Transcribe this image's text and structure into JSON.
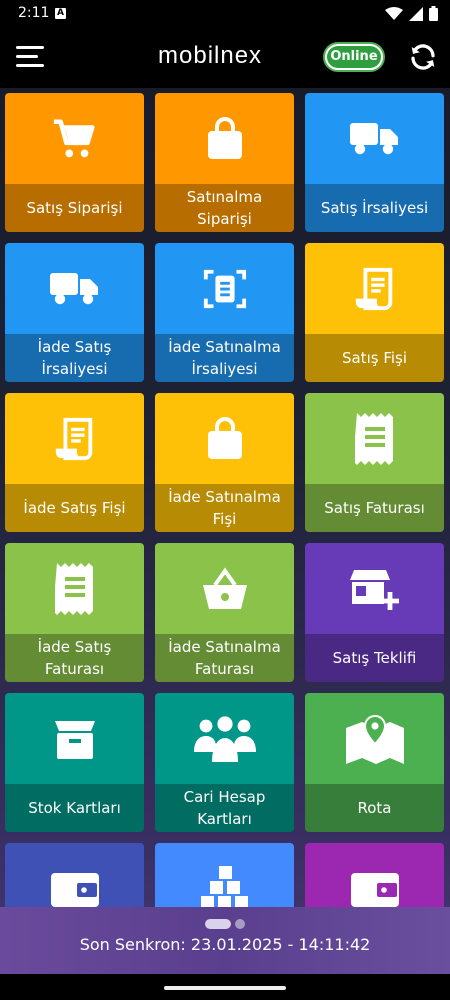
{
  "status_bar": {
    "time": "2:11",
    "notif_glyph": "A"
  },
  "app_bar": {
    "logo": "mobilnex",
    "online_label": "Online"
  },
  "tiles": [
    {
      "label": "Satış Siparişi",
      "color": "#ff9800",
      "icon": "cart-icon"
    },
    {
      "label": "Satınalma\nSiparişi",
      "color": "#ff9800",
      "icon": "shopping-bag-icon"
    },
    {
      "label": "Satış İrsaliyesi",
      "color": "#2196f3",
      "icon": "truck-icon"
    },
    {
      "label": "İade Satış\nİrsaliyesi",
      "color": "#2196f3",
      "icon": "truck-icon"
    },
    {
      "label": "İade Satınalma\nİrsaliyesi",
      "color": "#2196f3",
      "icon": "scan-document-icon"
    },
    {
      "label": "Satış Fişi",
      "color": "#ffc107",
      "icon": "receipt-scroll-icon"
    },
    {
      "label": "İade Satış Fişi",
      "color": "#ffc107",
      "icon": "receipt-scroll-icon"
    },
    {
      "label": "İade Satınalma\nFişi",
      "color": "#ffc107",
      "icon": "shopping-bag-icon"
    },
    {
      "label": "Satış Faturası",
      "color": "#8bc34a",
      "icon": "invoice-icon"
    },
    {
      "label": "İade Satış\nFaturası",
      "color": "#8bc34a",
      "icon": "invoice-icon"
    },
    {
      "label": "İade Satınalma\nFaturası",
      "color": "#8bc34a",
      "icon": "basket-icon"
    },
    {
      "label": "Satış Teklifi",
      "color": "#673ab7",
      "icon": "store-add-icon"
    },
    {
      "label": "Stok Kartları",
      "color": "#009688",
      "icon": "box-icon"
    },
    {
      "label": "Cari Hesap\nKartları",
      "color": "#009688",
      "icon": "users-icon"
    },
    {
      "label": "Rota",
      "color": "#4caf50",
      "icon": "map-pin-icon"
    },
    {
      "label": "",
      "color": "#3f51b5",
      "icon": "wallet-icon"
    },
    {
      "label": "",
      "color": "#448aff",
      "icon": "boxes-stack-icon"
    },
    {
      "label": "",
      "color": "#9c27b0",
      "icon": "wallet-icon"
    }
  ],
  "footer": {
    "sync_text": "Son Senkron: 23.01.2025 - 14:11:42"
  }
}
